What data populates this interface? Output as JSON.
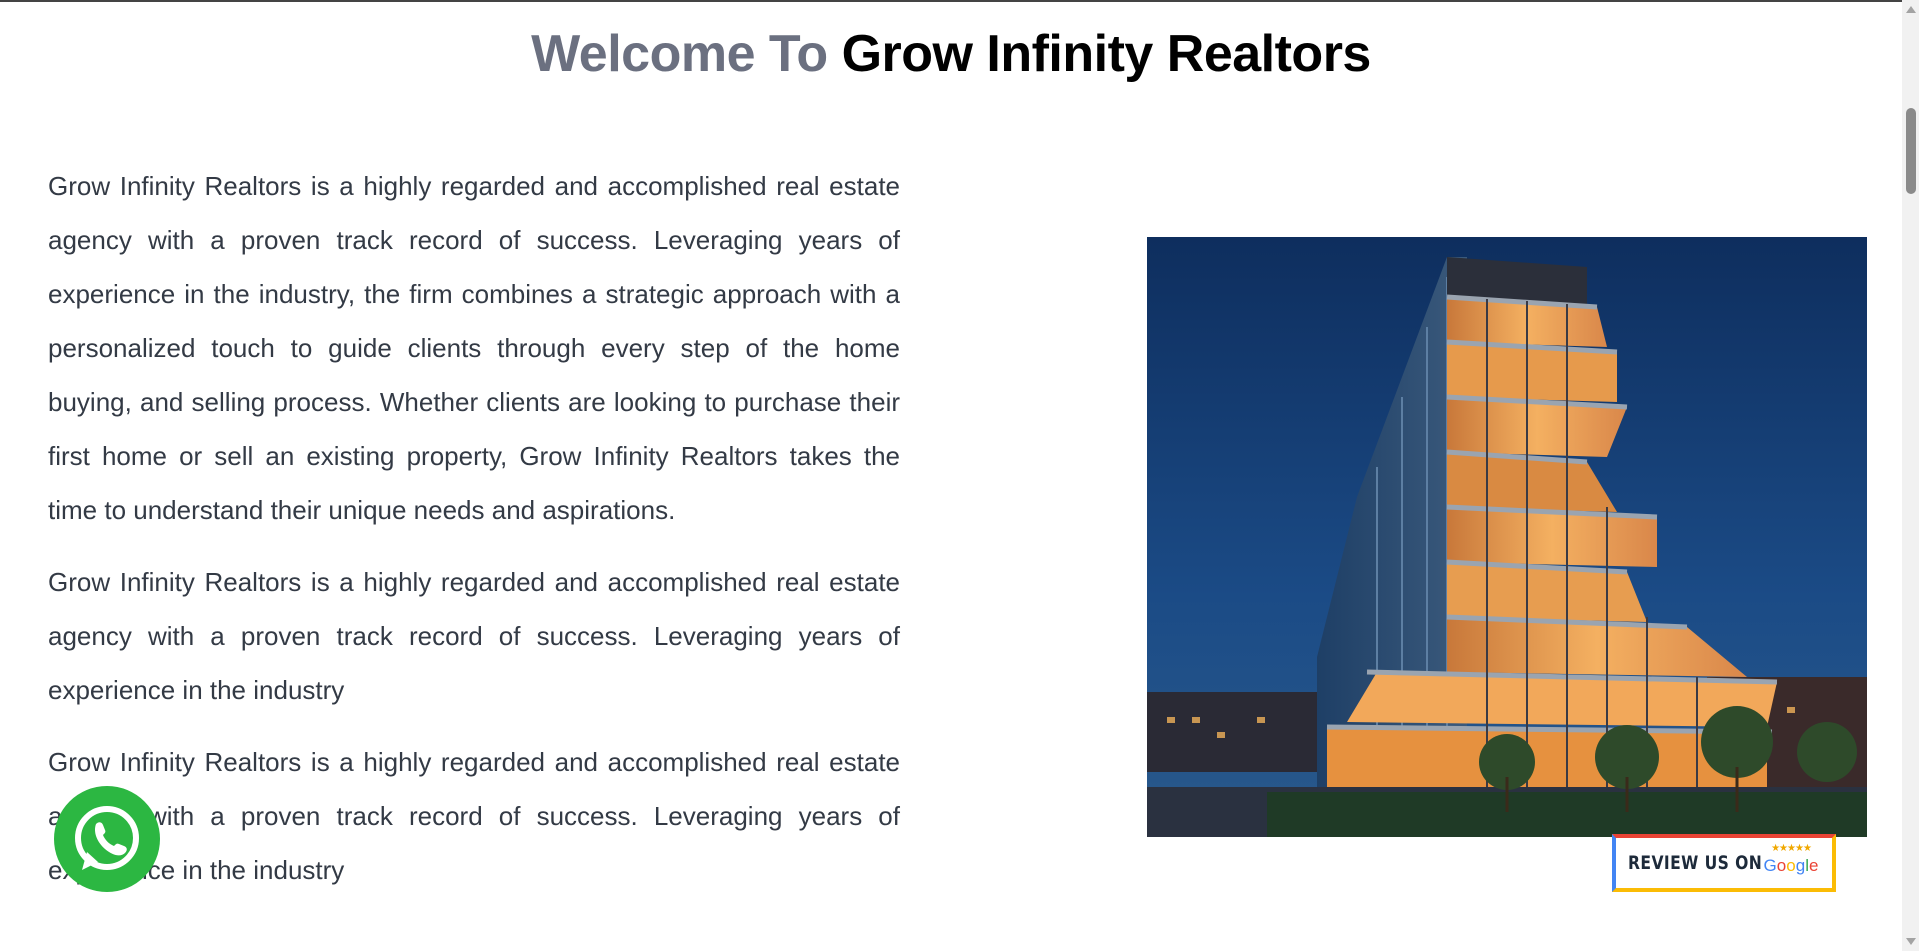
{
  "heading": {
    "part1": "Welcome To",
    "part2": "Grow Infinity Realtors"
  },
  "paragraphs": [
    "Grow Infinity Realtors is a highly regarded and accomplished real estate agency with a proven track record of success. Leveraging years of experience in the industry, the firm combines a strategic approach with a personalized touch to guide clients through every step of the home buying, and selling process. Whether clients are looking to purchase their first home or sell an existing property, Grow Infinity Realtors takes the time to understand their unique needs and aspirations.",
    "Grow Infinity Realtors is a highly regarded and accomplished real estate agency with a proven track record of success. Leveraging years of experience in the industry",
    "Grow Infinity Realtors is a highly regarded and accomplished real estate agency with a proven track record of success. Leveraging years of experience in the industry"
  ],
  "review_badge": {
    "label": "REVIEW US ON",
    "stars": "★★★★★",
    "brand": "Google"
  },
  "icons": {
    "whatsapp": "whatsapp-icon",
    "hero": "building-photo"
  },
  "colors": {
    "heading_gray": "#6b7080",
    "heading_black": "#000000",
    "body_text": "#333a45",
    "whatsapp_green": "#2cb742",
    "night_sky": "#163a6e",
    "warm_light": "#f4a04a"
  }
}
